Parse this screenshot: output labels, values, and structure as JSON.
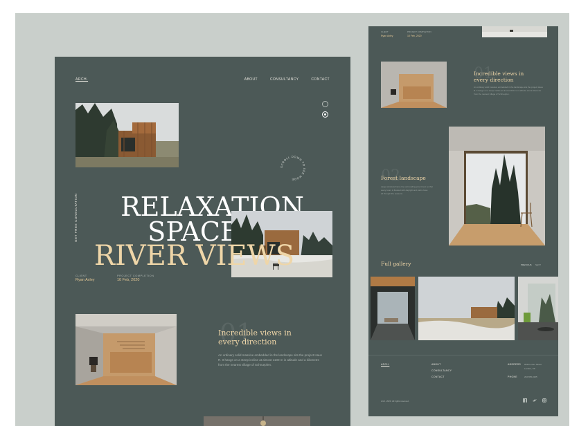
{
  "site": {
    "brand": "ARCH."
  },
  "nav": {
    "about": "ABOUT",
    "consultancy": "CONSULTANCY",
    "contact": "CONTACT"
  },
  "hero": {
    "line1": "RELAXATION",
    "line2": "SPACES",
    "line3": "RIVER VIEWS",
    "vertical_cta": "GET FREE CONSULTATION",
    "circle_text": "SCROLL DOWN TO SEE MORE"
  },
  "project": {
    "client_label": "CLIENT",
    "client_value": "Ryan Axley",
    "completion_label": "PROJECT COMPLETION",
    "completion_value": "10 Feb, 2020"
  },
  "section1": {
    "number": "01",
    "title_l1": "Incredible views in",
    "title_l2": "every direction",
    "body_l1": "An ordinary solid massive embedded in the landscape sits the project Haus",
    "body_l2": "R. It hangs on a steep incline at almost 1100 m in altitude and a kilometre",
    "body_l3": "from the nearest village of Schruepfen."
  },
  "right_panel": {
    "client_label": "CLIENT",
    "client_value": "Ryan Axley",
    "completion_label": "PROJECT COMPLETION",
    "completion_value": "10 Feb, 2020",
    "sec1_number": "01",
    "sec1_title_l1": "Incredible views in",
    "sec1_title_l2": "every direction",
    "sec1_body_l1": "An ordinary solid massive embedded in the landscape sits the project Haus",
    "sec1_body_l2": "R. It hangs on a steep incline at almost 1100 m in altitude and a kilometre",
    "sec1_body_l3": "from the nearest village of Schruepfen.",
    "sec2_number": "02",
    "sec2_title": "Forest landscape",
    "sec2_body_l1": "Large windows frame the surrounding pine forest so that",
    "sec2_body_l2": "every room is flooded with daylight and calm views",
    "sec2_body_l3": "all through the seasons.",
    "gallery_title": "Full gallery",
    "gallery_prev": "PREVIOUS",
    "gallery_next": "NEXT",
    "footer_brand": "ARCH.",
    "footer_about": "ABOUT",
    "footer_consultancy": "CONSULTANCY",
    "footer_contact": "CONTACT",
    "footer_address_label": "ADDRESS",
    "footer_address_l1": "2844 Lorem Street",
    "footer_address_l2": "London, UK",
    "footer_phone_label": "PHONE",
    "footer_phone_value": "202-555-0165",
    "copyright": "Arch. 2020. All rights reserved."
  },
  "colors": {
    "panel": "#4c5957",
    "accent": "#efd6a8",
    "backdrop": "#c9cfcb"
  }
}
